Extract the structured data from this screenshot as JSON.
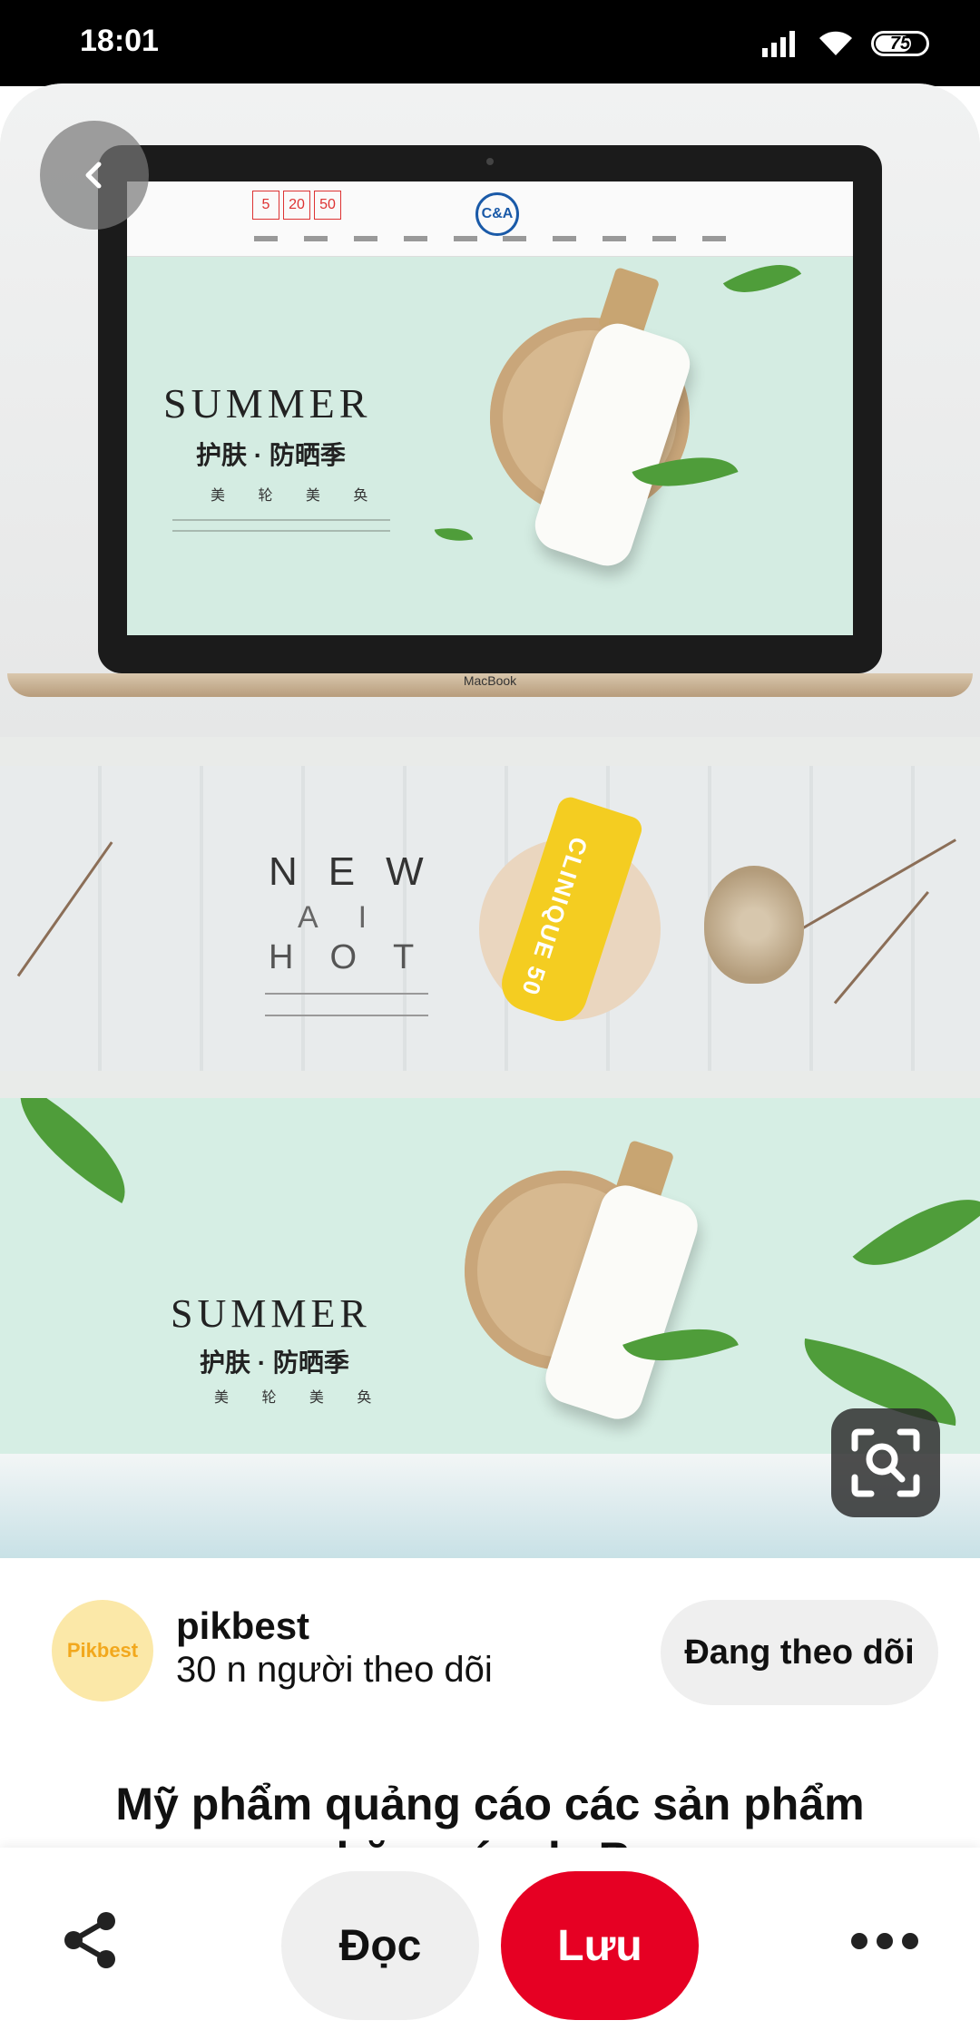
{
  "status_bar": {
    "time": "18:01",
    "battery": "75",
    "icons": [
      "signal-icon",
      "wifi-icon",
      "battery-icon"
    ]
  },
  "pin_image": {
    "laptop_banner": {
      "title": "SUMMER",
      "subtitle": "护肤 · 防晒季",
      "tags": "美 轮 美 奂",
      "brand": "C&A",
      "laptop_label": "MacBook",
      "promo": [
        "5",
        "20",
        "50"
      ]
    },
    "new_banner": {
      "line1": "NEW",
      "line2": "AI",
      "line3": "HOT",
      "product": "CLINIQUE 50"
    },
    "summer_banner": {
      "title": "SUMMER",
      "subtitle": "护肤 · 防晒季",
      "tags": "美 轮 美 奂"
    },
    "icons": [
      "back-arrow-icon",
      "visual-search-icon"
    ]
  },
  "creator": {
    "avatar_text": "Pikbest",
    "name": "pikbest",
    "followers": "30 n người theo dõi",
    "follow_label": "Đang theo dõi"
  },
  "pin": {
    "title_line1": "Mỹ phẩm quảng cáo các sản phẩm",
    "title_line2": "chăm sóc da B..."
  },
  "bottom_bar": {
    "read_label": "Đọc",
    "save_label": "Lưu",
    "icons": [
      "share-icon",
      "more-icon"
    ]
  },
  "colors": {
    "accent": "#e60023",
    "button_gray": "#efefef",
    "avatar_bg": "#fbe8a8"
  }
}
